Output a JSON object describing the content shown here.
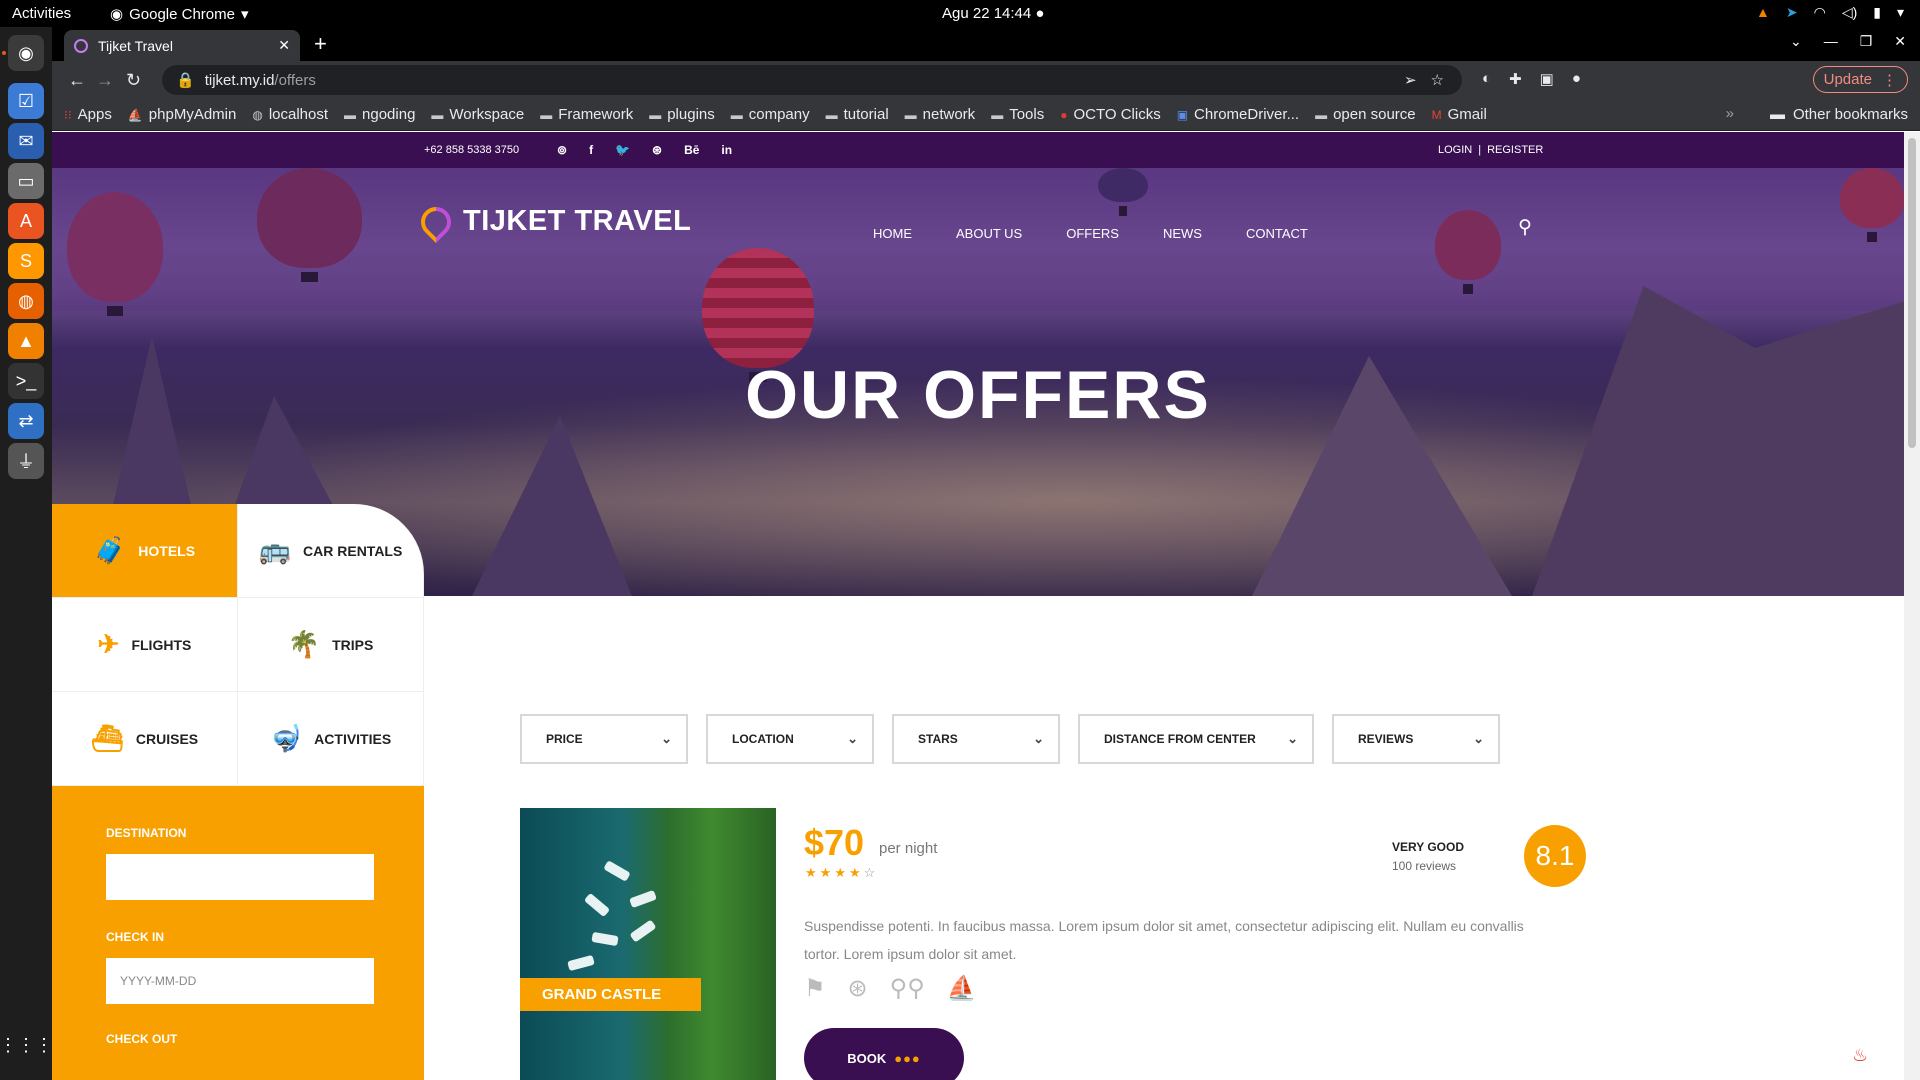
{
  "os": {
    "activities": "Activities",
    "app_name": "Google Chrome",
    "clock": "Agu 22  14:44"
  },
  "browser": {
    "tab_title": "Tijket Travel",
    "url_host": "tijket.my.id",
    "url_path": "/offers",
    "update_label": "Update",
    "bookmarks": [
      "Apps",
      "phpMyAdmin",
      "localhost",
      "ngoding",
      "Workspace",
      "Framework",
      "plugins",
      "company",
      "tutorial",
      "network",
      "Tools",
      "OCTO Clicks",
      "ChromeDriver...",
      "open source",
      "Gmail"
    ],
    "other_bookmarks": "Other bookmarks"
  },
  "site": {
    "phone": "+62 858 5338 3750",
    "social": [
      "pinterest-icon",
      "facebook-icon",
      "twitter-icon",
      "dribbble-icon",
      "behance-icon",
      "linkedin-icon"
    ],
    "social_labels": [
      "⊚",
      "f",
      "🐦",
      "⊛",
      "Bē",
      "in"
    ],
    "login": "LOGIN",
    "separator": "|",
    "register": "REGISTER",
    "brand": "TIJKET TRAVEL",
    "nav": [
      "HOME",
      "ABOUT US",
      "OFFERS",
      "NEWS",
      "CONTACT"
    ],
    "hero_title": "OUR OFFERS",
    "accent": "#f7a000",
    "brand_dark": "#3a0f52"
  },
  "categories": [
    {
      "label": "HOTELS",
      "icon": "suitcase-icon",
      "active": true
    },
    {
      "label": "CAR RENTALS",
      "icon": "bus-icon",
      "active": false
    },
    {
      "label": "FLIGHTS",
      "icon": "airplane-icon",
      "active": false
    },
    {
      "label": "TRIPS",
      "icon": "island-icon",
      "active": false
    },
    {
      "label": "CRUISES",
      "icon": "ship-icon",
      "active": false
    },
    {
      "label": "ACTIVITIES",
      "icon": "diving-mask-icon",
      "active": false
    }
  ],
  "search_panel": {
    "destination_label": "DESTINATION",
    "destination_value": "",
    "checkin_label": "CHECK IN",
    "checkin_placeholder": "YYYY-MM-DD",
    "checkout_label": "CHECK OUT"
  },
  "filters": [
    "PRICE",
    "LOCATION",
    "STARS",
    "DISTANCE FROM CENTER",
    "REVIEWS"
  ],
  "offer": {
    "name": "GRAND CASTLE",
    "price": "$70",
    "price_unit": "per night",
    "stars": 4,
    "stars_max": 5,
    "rating_label": "VERY GOOD",
    "reviews": "100 reviews",
    "score": "8.1",
    "description": "Suspendisse potenti. In faucibus massa. Lorem ipsum dolor sit amet, consectetur adipiscing elit. Nullam eu convallis tortor. Lorem ipsum dolor sit amet.",
    "amenities": [
      "signpost-icon",
      "compass-icon",
      "bicycle-icon",
      "sailboat-icon"
    ],
    "book_label": "BOOK"
  }
}
